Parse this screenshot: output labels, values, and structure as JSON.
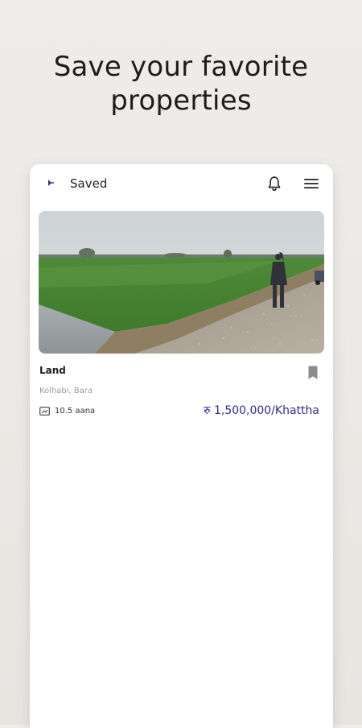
{
  "promo": {
    "headline_line1": "Save your favorite",
    "headline_line2": "properties"
  },
  "appbar": {
    "title": "Saved",
    "logo_icon": "app-logo-icon",
    "notification_icon": "bell-icon",
    "menu_icon": "hamburger-menu-icon",
    "accent_color": "#2f2b8c"
  },
  "listing": {
    "title": "Land",
    "location": "Kolhabi, Bara",
    "area": "10.5 aana",
    "price": "रु 1,500,000/Khattha",
    "bookmark_icon": "bookmark-icon",
    "area_icon": "area-icon"
  }
}
